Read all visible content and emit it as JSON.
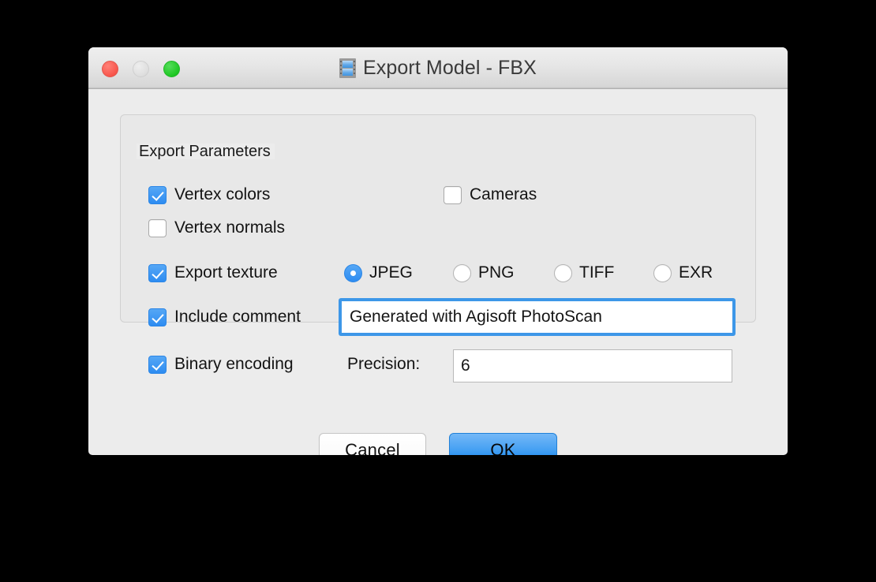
{
  "window": {
    "title": "Export Model - FBX",
    "icon": "film-strip-icon",
    "traffic_lights": {
      "close": "close-button",
      "minimize": "minimize-button",
      "maximize": "maximize-button"
    }
  },
  "group": {
    "legend": "Export Parameters"
  },
  "checkboxes": [
    {
      "id": "vertex-colors",
      "label": "Vertex colors",
      "checked": true
    },
    {
      "id": "cameras",
      "label": "Cameras",
      "checked": false
    },
    {
      "id": "vertex-normals",
      "label": "Vertex normals",
      "checked": false
    },
    {
      "id": "export-texture",
      "label": "Export texture",
      "checked": true
    },
    {
      "id": "include-comment",
      "label": "Include comment",
      "checked": true
    },
    {
      "id": "binary-encoding",
      "label": "Binary encoding",
      "checked": true
    }
  ],
  "texture_format": {
    "selected": "JPEG",
    "options": [
      {
        "label": "JPEG",
        "selected": true
      },
      {
        "label": "PNG",
        "selected": false
      },
      {
        "label": "TIFF",
        "selected": false
      },
      {
        "label": "EXR",
        "selected": false
      }
    ]
  },
  "comment": {
    "value": "Generated with Agisoft PhotoScan",
    "focused": true
  },
  "precision": {
    "label": "Precision:",
    "value": "6"
  },
  "buttons": {
    "cancel": "Cancel",
    "ok": "OK"
  },
  "colors": {
    "accent": "#2d8cf1",
    "focus_ring": "#3d97e8",
    "window_bg": "#ececec",
    "group_bg": "#e8e8e8",
    "close": "#f8564c",
    "minimize": "#dedede",
    "maximize": "#1ec723"
  }
}
